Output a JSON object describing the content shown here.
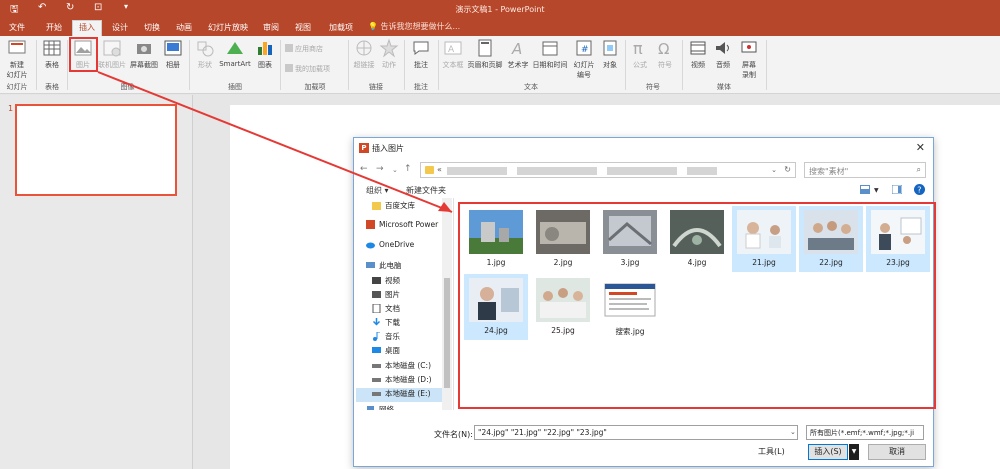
{
  "window": {
    "title": "演示文稿1 - PowerPoint"
  },
  "tabs": [
    "文件",
    "开始",
    "插入",
    "设计",
    "切换",
    "动画",
    "幻灯片放映",
    "审阅",
    "视图",
    "加载项"
  ],
  "tell_me": "告诉我您想要做什么...",
  "ribbon": {
    "new_slide": "新建\n幻灯片",
    "table": "表格",
    "picture": "图片",
    "online_picture": "联机图片",
    "screenshot": "屏幕截图",
    "album": "相册",
    "shapes": "形状",
    "smartart": "SmartArt",
    "chart": "图表",
    "store": "应用商店",
    "my_addins": "我的加载项",
    "hyperlink": "超链接",
    "action": "动作",
    "comment": "批注",
    "textbox": "文本框",
    "header_footer": "页眉和页脚",
    "wordart": "艺术字",
    "date_time": "日期和时间",
    "slide_number": "幻灯片\n编号",
    "object": "对象",
    "equation": "公式",
    "symbol": "符号",
    "video": "视频",
    "audio": "音频",
    "screen_recording": "屏幕\n录制",
    "groups": {
      "slides": "幻灯片",
      "tables": "表格",
      "images": "图像",
      "illustrations": "插图",
      "addins": "加载项",
      "links": "链接",
      "comments": "批注",
      "text": "文本",
      "symbols": "符号",
      "media": "媒体"
    }
  },
  "slides_pane": {
    "slide_number": "1"
  },
  "dialog": {
    "title": "插入图片",
    "path_prefix": "«",
    "search_placeholder": "搜索\"素材\"",
    "organize": "组织 ▾",
    "new_folder": "新建文件夹",
    "tree": [
      {
        "label": "百度文库",
        "icon": "folder-icon"
      },
      {
        "label": "Microsoft Power",
        "icon": "powerpoint-icon"
      },
      {
        "label": "OneDrive",
        "icon": "cloud-icon"
      },
      {
        "label": "此电脑",
        "icon": "computer-icon"
      },
      {
        "label": "视频",
        "icon": "video-folder-icon"
      },
      {
        "label": "图片",
        "icon": "pictures-folder-icon"
      },
      {
        "label": "文档",
        "icon": "documents-folder-icon"
      },
      {
        "label": "下载",
        "icon": "download-icon"
      },
      {
        "label": "音乐",
        "icon": "music-icon"
      },
      {
        "label": "桌面",
        "icon": "desktop-icon"
      },
      {
        "label": "本地磁盘 (C:)",
        "icon": "drive-icon"
      },
      {
        "label": "本地磁盘 (D:)",
        "icon": "drive-icon"
      },
      {
        "label": "本地磁盘 (E:)",
        "icon": "drive-icon"
      },
      {
        "label": "网络",
        "icon": "network-icon"
      }
    ],
    "files": [
      {
        "name": "1.jpg",
        "selected": false
      },
      {
        "name": "2.jpg",
        "selected": false
      },
      {
        "name": "3.jpg",
        "selected": false
      },
      {
        "name": "4.jpg",
        "selected": false
      },
      {
        "name": "21.jpg",
        "selected": true
      },
      {
        "name": "22.jpg",
        "selected": true
      },
      {
        "name": "23.jpg",
        "selected": true
      },
      {
        "name": "24.jpg",
        "selected": true
      },
      {
        "name": "25.jpg",
        "selected": false
      },
      {
        "name": "搜索.jpg",
        "selected": false
      }
    ],
    "filename_label": "文件名(N):",
    "filename_value": "\"24.jpg\" \"21.jpg\" \"22.jpg\" \"23.jpg\"",
    "filetype_value": "所有图片(*.emf;*.wmf;*.jpg;*.ji",
    "tools": "工具(L)",
    "insert": "插入(S)",
    "cancel": "取消"
  },
  "colors": {
    "accent": "#b7472a",
    "highlight": "#e53935",
    "selection": "#cce8ff"
  }
}
